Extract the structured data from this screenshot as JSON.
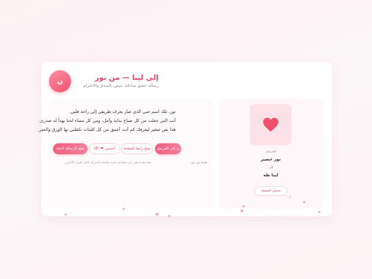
{
  "header": {
    "avatar_letter": "ن",
    "title": "إلى لينا — من نور",
    "subtitle": "رسالة عشق صادقة، تنبض بالصدق والاحترام"
  },
  "message": {
    "lines": [
      "نور، تلك اسم حبي الذي صار يعرف طريقي إلى راحة قلبي.",
      "أنت التي جعلت من كل صباح بداية وأمل، ومن كل مساء لحنا يهدأ له صدري.",
      "هذا نص صغير ليعرفك كم أنت أعمق من كل كلمات تكفلني بها الورق والحبر."
    ]
  },
  "actions": {
    "send_label": "رد إلى المرسل",
    "copy_link_label": "نسخ رابط الصفحة",
    "like_label": "أعجبني",
    "like_count": "(8)",
    "heart_glyph": "❤",
    "analyze_label": "تقيّم الرسالة كاملة"
  },
  "meta": {
    "note": "هذه هدية تعبر عن مشاعر حبية صادقة واحترام كامل لقرار الآخرين",
    "sender": "هدية من نور"
  },
  "side": {
    "heart_icon": "heart-icon",
    "sender_label": "المرسل",
    "sender_name": "نور خضير",
    "recipient_label": "إلى",
    "recipient_name": "لينا طه",
    "download_label": "تحميل الصفحة"
  },
  "colors": {
    "accent": "#f0506e",
    "heart": "#f0506e",
    "panel_pink": "#fde1e8"
  }
}
